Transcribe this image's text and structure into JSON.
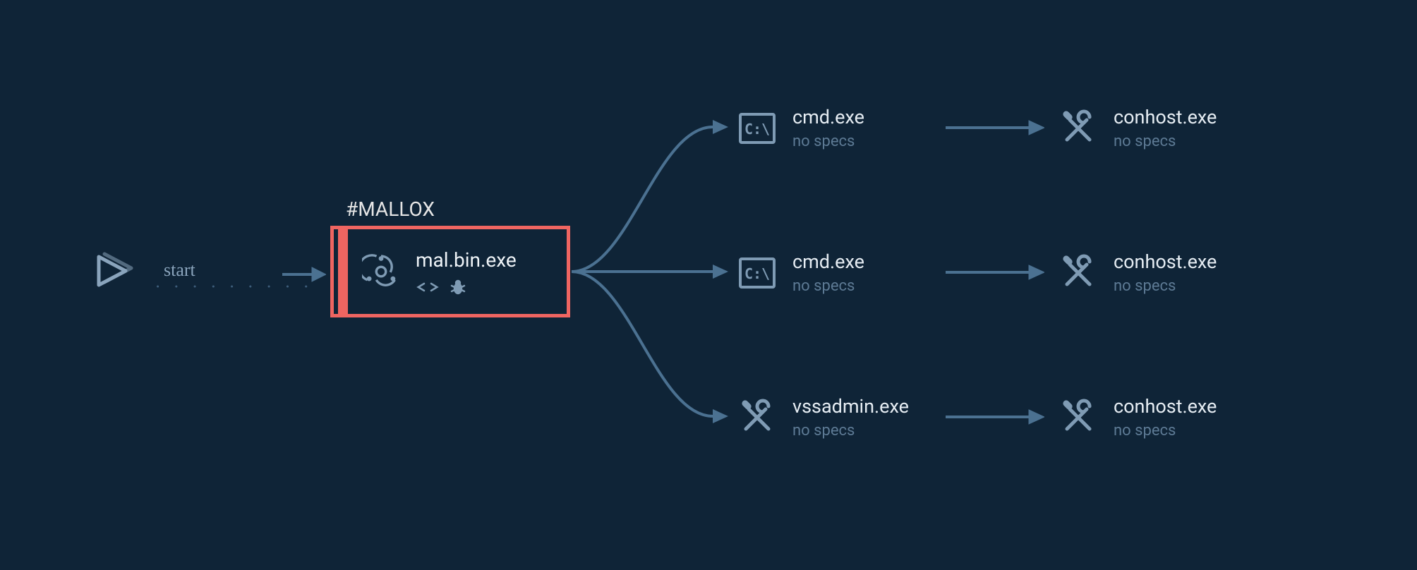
{
  "start_label": "start",
  "malicious": {
    "tag": "#MALLOX",
    "name": "mal.bin.exe"
  },
  "children": [
    {
      "name": "cmd.exe",
      "sub": "no specs",
      "icon": "cmd"
    },
    {
      "name": "cmd.exe",
      "sub": "no specs",
      "icon": "cmd"
    },
    {
      "name": "vssadmin.exe",
      "sub": "no specs",
      "icon": "tools"
    }
  ],
  "grandchildren": [
    {
      "name": "conhost.exe",
      "sub": "no specs",
      "icon": "tools"
    },
    {
      "name": "conhost.exe",
      "sub": "no specs",
      "icon": "tools"
    },
    {
      "name": "conhost.exe",
      "sub": "no specs",
      "icon": "tools"
    }
  ],
  "colors": {
    "bg": "#0f2437",
    "danger": "#ef6561",
    "muted": "#7f9bb4",
    "text": "#e6edf3",
    "arrow": "#4b7191"
  }
}
